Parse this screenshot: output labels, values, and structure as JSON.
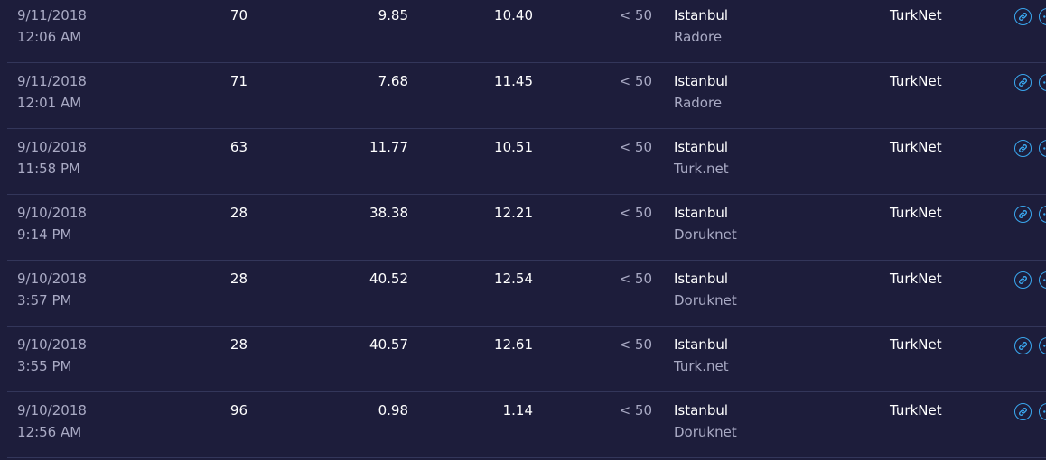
{
  "colors": {
    "background": "#1d1d3b",
    "divider": "#33365a",
    "primary_text": "#ffffff",
    "secondary_text": "#a9aac4",
    "accent": "#3aa8f0"
  },
  "icons": {
    "link": "link-icon",
    "more": "more-options-icon"
  },
  "rows": [
    {
      "date": "9/11/2018",
      "time": "12:06 AM",
      "ping": "70",
      "download": "9.85",
      "upload": "10.40",
      "distance": "< 50",
      "city": "Istanbul",
      "host": "Radore",
      "isp": "TurkNet"
    },
    {
      "date": "9/11/2018",
      "time": "12:01 AM",
      "ping": "71",
      "download": "7.68",
      "upload": "11.45",
      "distance": "< 50",
      "city": "Istanbul",
      "host": "Radore",
      "isp": "TurkNet"
    },
    {
      "date": "9/10/2018",
      "time": "11:58 PM",
      "ping": "63",
      "download": "11.77",
      "upload": "10.51",
      "distance": "< 50",
      "city": "Istanbul",
      "host": "Turk.net",
      "isp": "TurkNet"
    },
    {
      "date": "9/10/2018",
      "time": "9:14 PM",
      "ping": "28",
      "download": "38.38",
      "upload": "12.21",
      "distance": "< 50",
      "city": "Istanbul",
      "host": "Doruknet",
      "isp": "TurkNet"
    },
    {
      "date": "9/10/2018",
      "time": "3:57 PM",
      "ping": "28",
      "download": "40.52",
      "upload": "12.54",
      "distance": "< 50",
      "city": "Istanbul",
      "host": "Doruknet",
      "isp": "TurkNet"
    },
    {
      "date": "9/10/2018",
      "time": "3:55 PM",
      "ping": "28",
      "download": "40.57",
      "upload": "12.61",
      "distance": "< 50",
      "city": "Istanbul",
      "host": "Turk.net",
      "isp": "TurkNet"
    },
    {
      "date": "9/10/2018",
      "time": "12:56 AM",
      "ping": "96",
      "download": "0.98",
      "upload": "1.14",
      "distance": "< 50",
      "city": "Istanbul",
      "host": "Doruknet",
      "isp": "TurkNet"
    }
  ]
}
